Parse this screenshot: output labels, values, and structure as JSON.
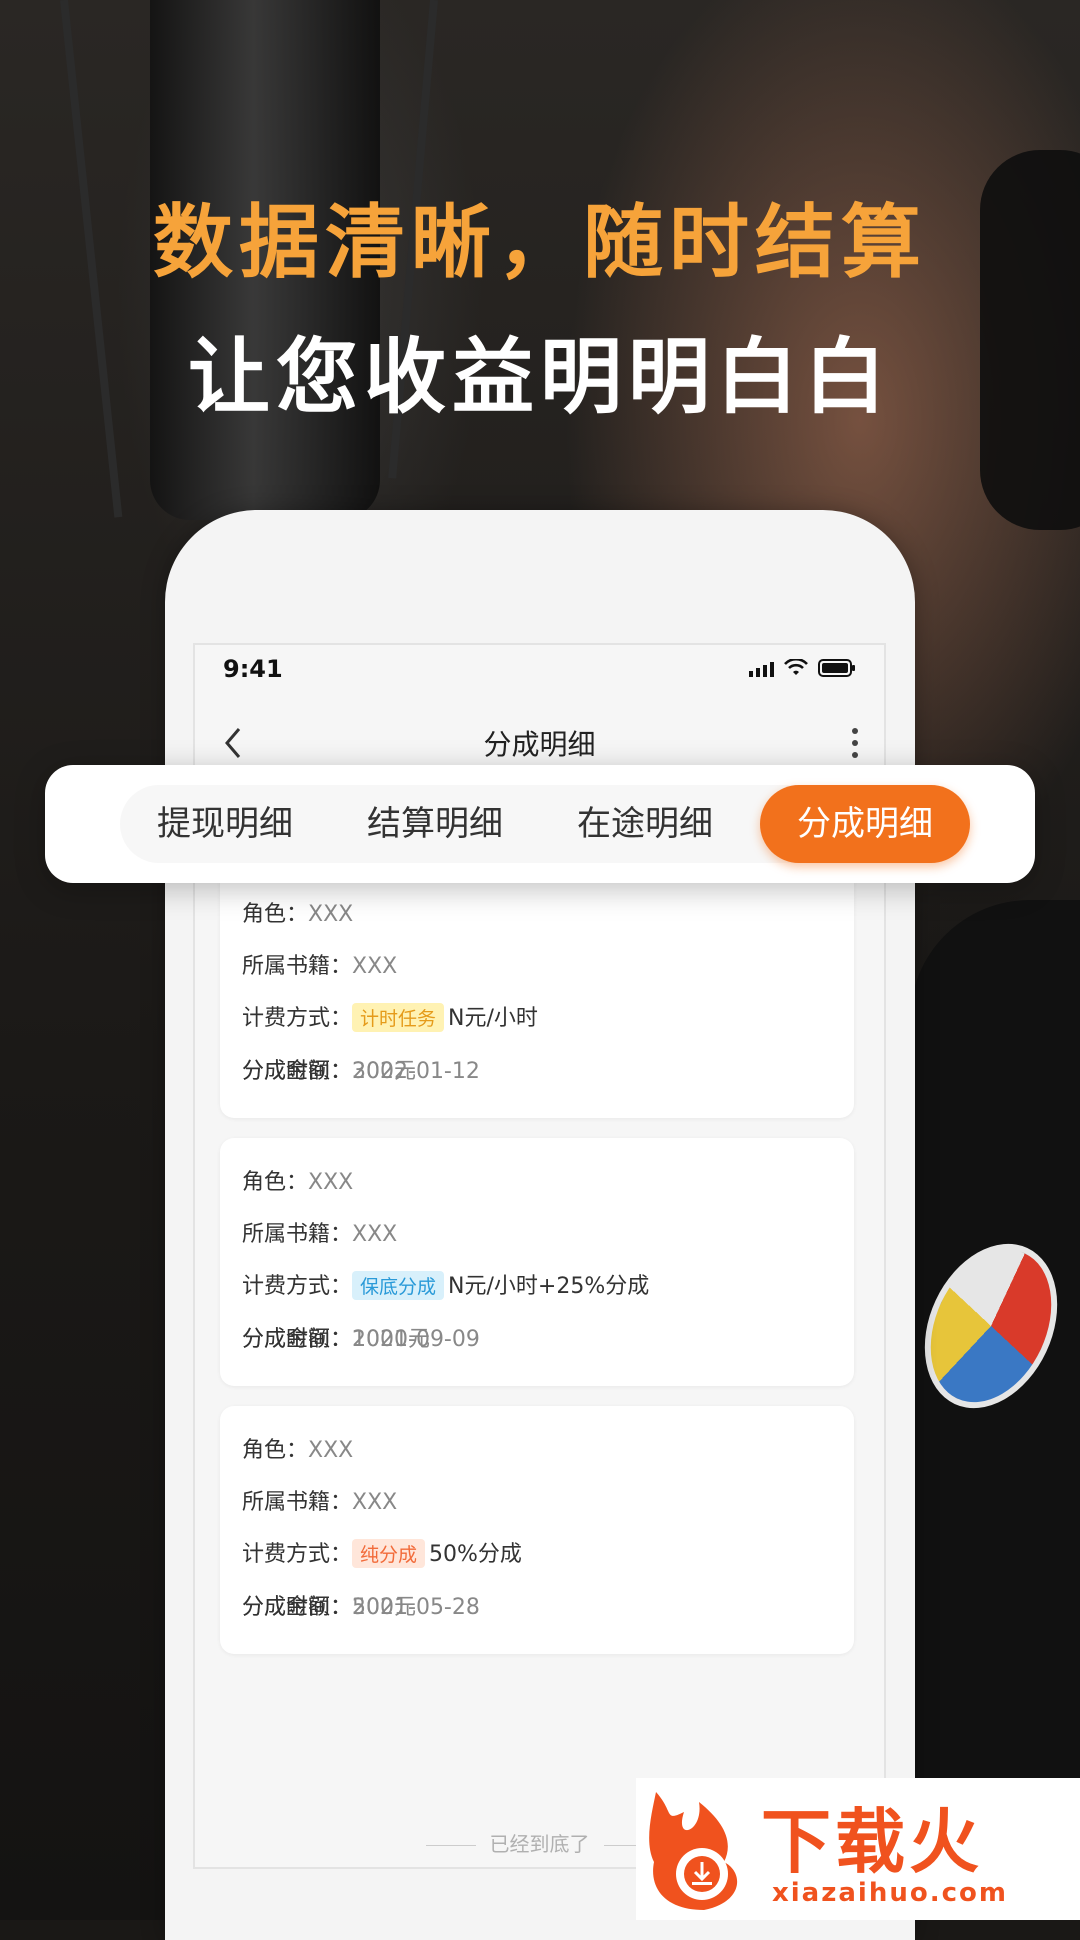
{
  "headline": {
    "line1": "数据清晰，随时结算",
    "line2": "让您收益明明白白"
  },
  "status_bar": {
    "time": "9:41"
  },
  "nav": {
    "title": "分成明细"
  },
  "tabs": [
    {
      "label": "提现明细",
      "active": false
    },
    {
      "label": "结算明细",
      "active": false
    },
    {
      "label": "在途明细",
      "active": false
    },
    {
      "label": "分成明细",
      "active": true
    }
  ],
  "labels": {
    "role": "角色：",
    "book": "所属书籍：",
    "billing": "计费方式：",
    "amount": "分成金额：",
    "time": "分成时间："
  },
  "records": [
    {
      "role": "XXX",
      "book": "XXX",
      "tag": "计时任务",
      "tag_color": "#e59b1a",
      "billing": "N元/小时",
      "amount": "300元",
      "time": "2022-01-12"
    },
    {
      "role": "XXX",
      "book": "XXX",
      "tag": "保底分成",
      "tag_color": "#2a9ad8",
      "billing": "N元/小时+25%分成",
      "amount": "1000元",
      "time": "2021-09-09"
    },
    {
      "role": "XXX",
      "book": "XXX",
      "tag": "纯分成",
      "tag_color": "#f26b3a",
      "billing": "50%分成",
      "amount": "500元",
      "time": "2021-05-28"
    }
  ],
  "footer": {
    "end_text": "已经到底了"
  },
  "watermark": {
    "brand": "下载火",
    "url": "xiazaihuo.com"
  },
  "colors": {
    "accent": "#f2711c",
    "headline_orange": "#f6a33a"
  }
}
